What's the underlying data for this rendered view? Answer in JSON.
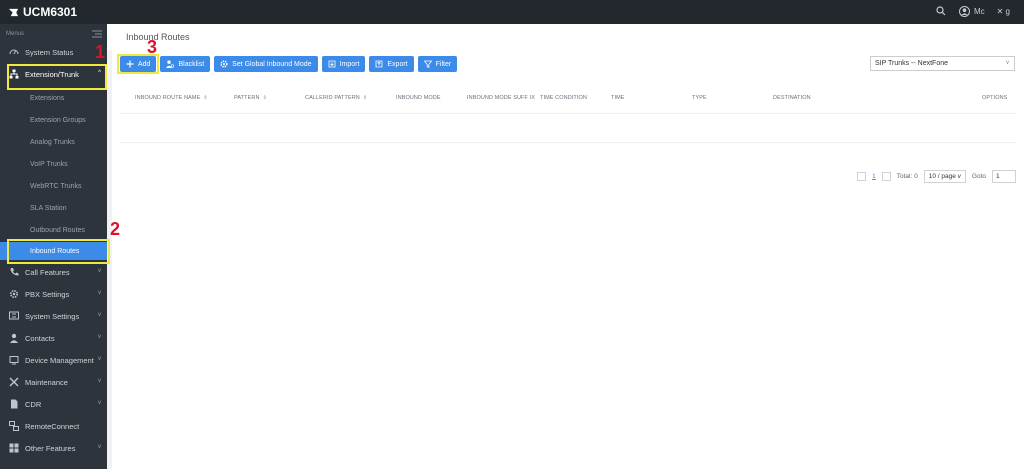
{
  "app": {
    "title": "UCM6301"
  },
  "header": {
    "user_name": "Mc",
    "lang": "✕ g"
  },
  "sidebar": {
    "heading": "Menus",
    "items": [
      {
        "label": "System Status"
      },
      {
        "label": "Extension/Trunk"
      },
      {
        "label": "Call Features"
      },
      {
        "label": "PBX Settings"
      },
      {
        "label": "System Settings"
      },
      {
        "label": "Contacts"
      },
      {
        "label": "Device Management"
      },
      {
        "label": "Maintenance"
      },
      {
        "label": "CDR"
      },
      {
        "label": "RemoteConnect"
      },
      {
        "label": "Other Features"
      }
    ],
    "subitems": [
      {
        "label": "Extensions"
      },
      {
        "label": "Extension Groups"
      },
      {
        "label": "Analog Trunks"
      },
      {
        "label": "VoIP Trunks"
      },
      {
        "label": "WebRTC Trunks"
      },
      {
        "label": "SLA Station"
      },
      {
        "label": "Outbound Routes"
      },
      {
        "label": "Inbound Routes"
      }
    ]
  },
  "page": {
    "title": "Inbound Routes"
  },
  "toolbar": {
    "add": "Add",
    "blacklist": "Blacklist",
    "global_mode": "Set Global Inbound Mode",
    "import": "Import",
    "export": "Export",
    "filter": "Filter"
  },
  "trunk_filter": {
    "value": "SIP Trunks -- NextFone"
  },
  "table": {
    "columns": [
      "INBOUND ROUTE NAME",
      "PATTERN",
      "CALLERID PATTERN",
      "INBOUND MODE",
      "INBOUND MODE SUFF IX",
      "TIME CONDITION",
      "TIME",
      "TYPE",
      "DESTINATION",
      "OPTIONS"
    ],
    "rows": []
  },
  "pagination": {
    "page": "1",
    "total": "Total: 0",
    "per_page": "10 / page",
    "goto_label": "Goto",
    "goto_value": "1"
  },
  "annotations": [
    "1",
    "2",
    "3"
  ],
  "colors": {
    "accent": "#3d8be8",
    "highlight": "#f0e83a",
    "annotation": "#e0102a",
    "sidebar": "#2e343c",
    "topbar": "#23282f"
  }
}
